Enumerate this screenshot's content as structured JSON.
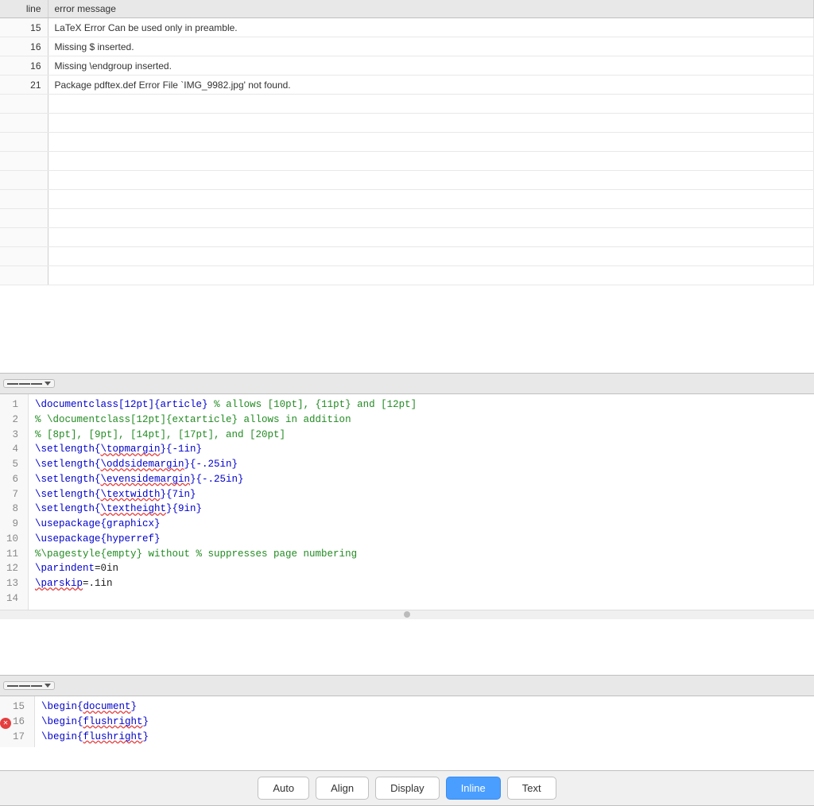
{
  "error_table": {
    "headers": [
      "line",
      "error message"
    ],
    "rows": [
      {
        "line": "15",
        "message": "LaTeX Error Can be used only in preamble."
      },
      {
        "line": "16",
        "message": "Missing $ inserted."
      },
      {
        "line": "16",
        "message": "Missing \\endgroup inserted."
      },
      {
        "line": "21",
        "message": "Package pdftex.def Error File `IMG_9982.jpg' not found."
      }
    ],
    "empty_rows": 10
  },
  "code_panel_1": {
    "menu_label": "menu",
    "lines": [
      {
        "num": "1",
        "content": "\\documentclass[12pt]{article} % allows [10pt], {11pt} and [12pt]"
      },
      {
        "num": "2",
        "content": "% \\documentclass[12pt]{extarticle} allows in addition"
      },
      {
        "num": "3",
        "content": "% [8pt], [9pt], [14pt], [17pt], and [20pt]"
      },
      {
        "num": "4",
        "content": ""
      },
      {
        "num": "5",
        "content": "\\setlength{\\topmargin}{-1in}"
      },
      {
        "num": "6",
        "content": "\\setlength{\\oddsidemargin}{-.25in}"
      },
      {
        "num": "7",
        "content": "\\setlength{\\evensidemargin}{-.25in}"
      },
      {
        "num": "8",
        "content": "\\setlength{\\textwidth}{7in}"
      },
      {
        "num": "9",
        "content": "\\setlength{\\textheight}{9in}"
      },
      {
        "num": "10",
        "content": "\\usepackage{graphicx}"
      },
      {
        "num": "11",
        "content": "\\usepackage{hyperref}"
      },
      {
        "num": "12",
        "content": "%\\pagestyle{empty} without % suppresses page numbering"
      },
      {
        "num": "13",
        "content": "\\parindent=0in"
      },
      {
        "num": "14",
        "content": "\\parskip=.1in"
      }
    ]
  },
  "code_panel_2": {
    "menu_label": "menu",
    "error_line": "16",
    "lines": [
      {
        "num": "15",
        "content": "\\begin{document}"
      },
      {
        "num": "16",
        "content": "\\begin{flushright}"
      },
      {
        "num": "17",
        "content": "\\begin{flushright}"
      }
    ]
  },
  "toolbar": {
    "buttons": [
      {
        "label": "Auto",
        "id": "auto"
      },
      {
        "label": "Align",
        "id": "align"
      },
      {
        "label": "Display",
        "id": "display"
      },
      {
        "label": "Inline",
        "id": "inline",
        "active": true
      },
      {
        "label": "Text",
        "id": "text"
      }
    ]
  }
}
